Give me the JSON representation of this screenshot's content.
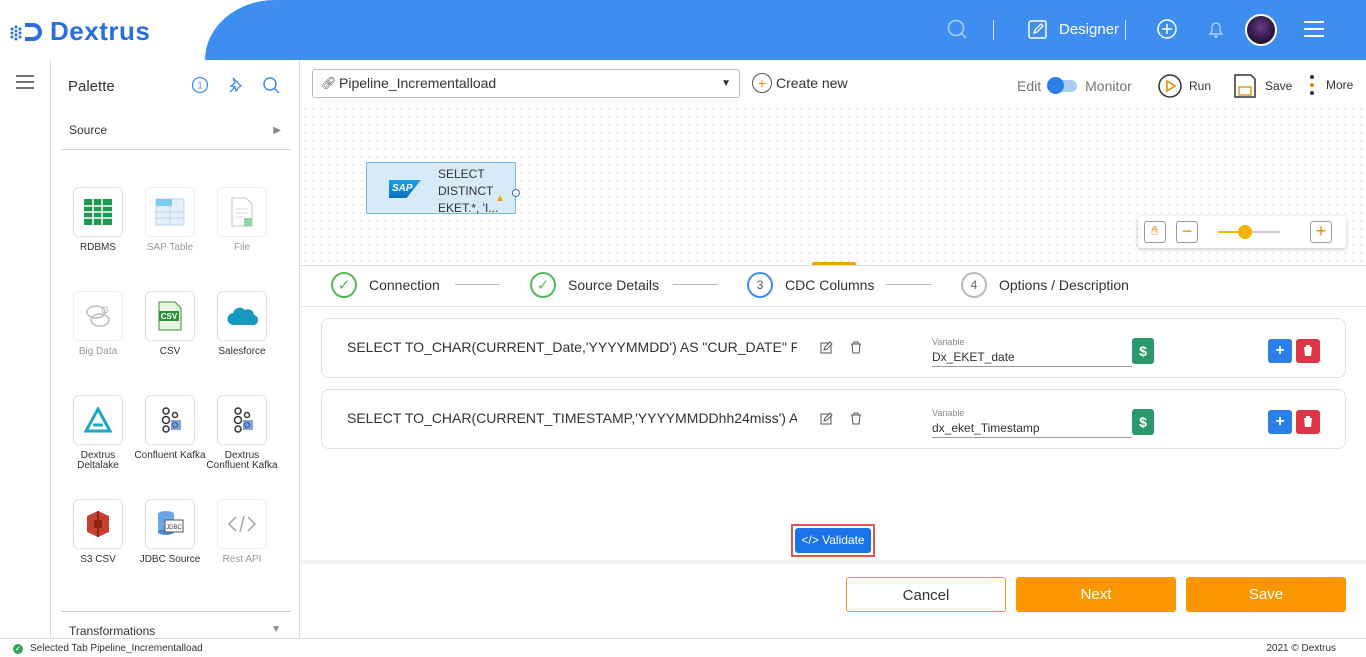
{
  "header": {
    "logo_text": "Dextrus",
    "designer_label": "Designer"
  },
  "palette": {
    "title": "Palette",
    "source_label": "Source",
    "transformations_label": "Transformations",
    "tiles": [
      {
        "label": "RDBMS",
        "icon": "rdbms-grid-icon"
      },
      {
        "label": "SAP Table",
        "icon": "sap-table-icon"
      },
      {
        "label": "File",
        "icon": "file-icon"
      },
      {
        "label": "Big Data",
        "icon": "big-data-icon"
      },
      {
        "label": "CSV",
        "icon": "csv-icon"
      },
      {
        "label": "Salesforce",
        "icon": "salesforce-cloud-icon"
      },
      {
        "label": "Dextrus Deltalake",
        "icon": "deltalake-icon"
      },
      {
        "label": "Confluent Kafka",
        "icon": "kafka-icon"
      },
      {
        "label": "Dextrus Confluent Kafka",
        "icon": "kafka-icon"
      },
      {
        "label": "S3 CSV",
        "icon": "s3-icon"
      },
      {
        "label": "JDBC Source",
        "icon": "jdbc-icon"
      },
      {
        "label": "Rest API",
        "icon": "code-icon"
      }
    ]
  },
  "toolbar": {
    "pipeline_name": "Pipeline_Incrementalload",
    "create_new_label": "Create new",
    "edit_label": "Edit",
    "monitor_label": "Monitor",
    "run_label": "Run",
    "save_label": "Save",
    "more_label": "More"
  },
  "canvas": {
    "node_logo": "SAP",
    "node_text_1": "SELECT",
    "node_text_2": "DISTINCT",
    "node_text_3": "EKET.*, 'I..."
  },
  "stepper": {
    "steps": [
      {
        "num": "✓",
        "label": "Connection",
        "state": "done"
      },
      {
        "num": "✓",
        "label": "Source Details",
        "state": "done"
      },
      {
        "num": "3",
        "label": "CDC Columns",
        "state": "active"
      },
      {
        "num": "4",
        "label": "Options / Description",
        "state": "todo"
      }
    ]
  },
  "cdc_rows": [
    {
      "query": "SELECT TO_CHAR(CURRENT_Date,'YYYYMMDD') AS \"CUR_DATE\" F...",
      "variable_label": "Variable",
      "variable_value": "Dx_EKET_date"
    },
    {
      "query": "SELECT TO_CHAR(CURRENT_TIMESTAMP,'YYYYMMDDhh24miss') A...",
      "variable_label": "Variable",
      "variable_value": "dx_eket_Timestamp"
    }
  ],
  "validate_label": "Validate",
  "footer": {
    "cancel_label": "Cancel",
    "next_label": "Next",
    "save_label": "Save"
  },
  "statusbar": {
    "status_text": "Selected Tab Pipeline_Incrementalload",
    "copyright": "2021 © Dextrus"
  },
  "colors": {
    "header_blue": "#3d8ef0",
    "accent_orange": "#fa9600",
    "success_green": "#57b85a",
    "danger_red": "#dc3545"
  }
}
